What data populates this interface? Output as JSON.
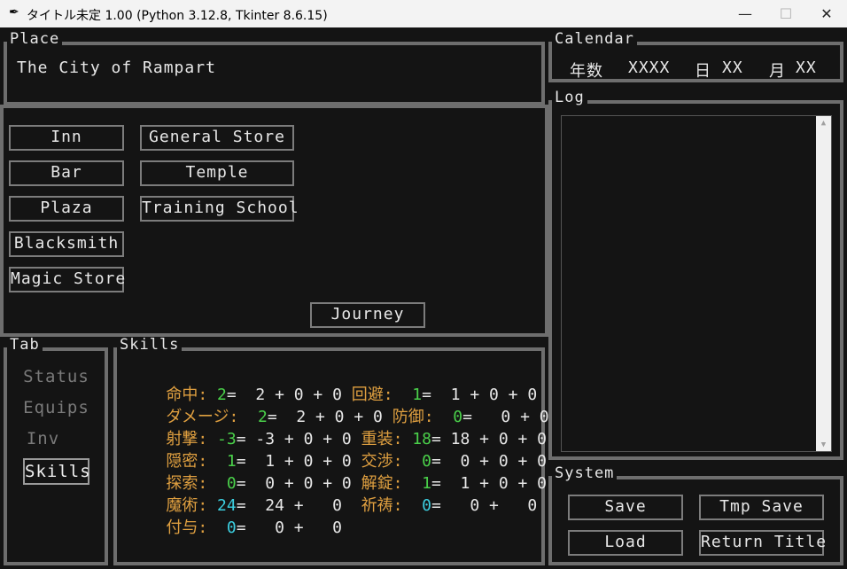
{
  "window": {
    "title": "タイトル未定 1.00 (Python 3.12.8, Tkinter 8.6.15)",
    "minimize": "—",
    "maximize": "☐",
    "close": "✕"
  },
  "place": {
    "label": "Place",
    "name": "The City of Rampart"
  },
  "calendar": {
    "label": "Calendar",
    "year_label": "年数",
    "year": "XXXX",
    "day_label": "日",
    "day": "XX",
    "month_label": "月",
    "month": "XX"
  },
  "locations": [
    "Inn",
    "General Store",
    "Bar",
    "Temple",
    "Plaza",
    "Training School",
    "Blacksmith",
    "Magic Store"
  ],
  "journey_label": "Journey",
  "log": {
    "label": "Log",
    "up_arrow": "▲",
    "down_arrow": "▼"
  },
  "tabs": {
    "label": "Tab",
    "items": [
      "Status",
      "Equips",
      "Inv",
      "Skills"
    ],
    "active": "Skills"
  },
  "skills": {
    "label": "Skills",
    "rows": [
      [
        {
          "name": "命中:",
          "val": " 2",
          "rest": "=  2 + 0 + 0 "
        },
        {
          "name": "回避:",
          "val": "  1",
          "rest": "=  1 + 0 + 0"
        }
      ],
      [
        {
          "name": "ダメージ:",
          "val": "  2",
          "rest": "=  2 + 0 + 0 "
        },
        {
          "name": "防御:",
          "val": "  0",
          "rest": "=   0 + 0"
        }
      ],
      [
        {
          "name": "射撃:",
          "val": " -3",
          "rest": "= -3 + 0 + 0 "
        },
        {
          "name": "重装:",
          "val": " 18",
          "rest": "= 18 + 0 + 0"
        }
      ],
      [
        {
          "name": "隠密:",
          "val": "  1",
          "rest": "=  1 + 0 + 0 "
        },
        {
          "name": "交渉:",
          "val": "  0",
          "rest": "=  0 + 0 + 0"
        }
      ],
      [
        {
          "name": "探索:",
          "val": "  0",
          "rest": "=  0 + 0 + 0 "
        },
        {
          "name": "解錠:",
          "val": "  1",
          "rest": "=  1 + 0 + 0"
        }
      ],
      [
        {
          "name": "魔術:",
          "val": " 24",
          "rest": "=  24 +   0  "
        },
        {
          "name": "祈祷:",
          "val": "  0",
          "rest": "=   0 +   0"
        }
      ],
      [
        {
          "name": "付与:",
          "val": "  0",
          "rest": "=   0 +   0"
        }
      ]
    ]
  },
  "system": {
    "label": "System",
    "save": "Save",
    "tmp_save": "Tmp Save",
    "load": "Load",
    "return_title": "Return Title"
  }
}
